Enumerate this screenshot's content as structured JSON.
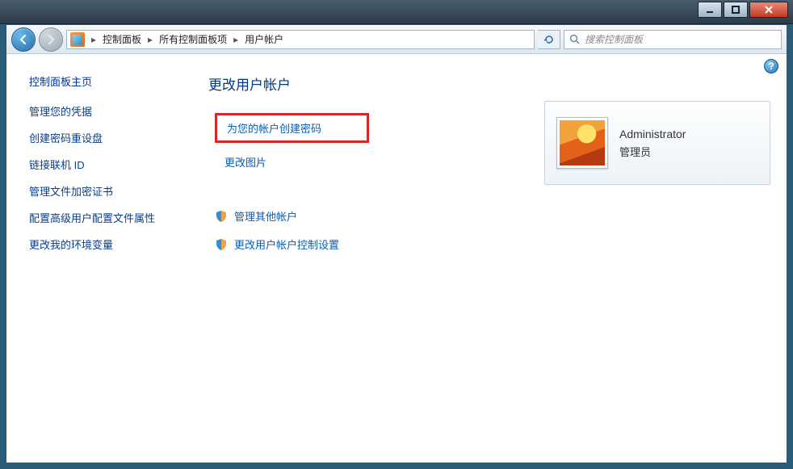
{
  "breadcrumbs": {
    "items": [
      "控制面板",
      "所有控制面板项",
      "用户帐户"
    ]
  },
  "search": {
    "placeholder": "搜索控制面板"
  },
  "help_glyph": "?",
  "sidebar": {
    "title": "控制面板主页",
    "links": [
      "管理您的凭据",
      "创建密码重设盘",
      "链接联机 ID",
      "管理文件加密证书",
      "配置高级用户配置文件属性",
      "更改我的环境变量"
    ]
  },
  "main": {
    "heading": "更改用户帐户",
    "options": {
      "create_password": "为您的帐户创建密码",
      "change_picture": "更改图片",
      "manage_other": "管理其他帐户",
      "change_uac": "更改用户帐户控制设置"
    }
  },
  "user": {
    "name": "Administrator",
    "role": "管理员"
  }
}
